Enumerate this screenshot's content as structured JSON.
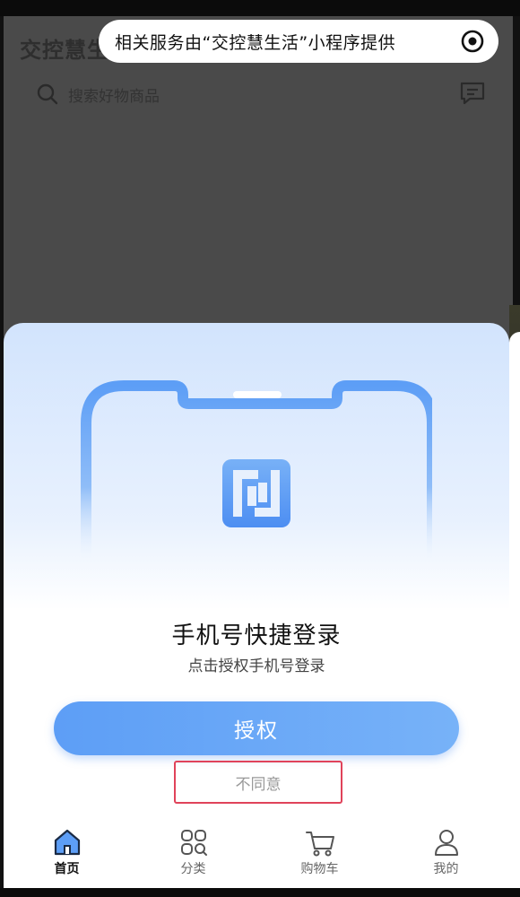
{
  "capsule": {
    "text": "相关服务由“交控慧生活”小程序提供",
    "icon": "target-icon"
  },
  "app": {
    "title": "交控慧生活",
    "search_placeholder": "搜索好物商品",
    "message_icon": "message-icon"
  },
  "login": {
    "title": "手机号快捷登录",
    "subtitle": "点击授权手机号登录",
    "authorize_label": "授权",
    "disagree_label": "不同意"
  },
  "tabbar": {
    "items": [
      {
        "label": "首页",
        "icon": "home-icon",
        "active": true
      },
      {
        "label": "分类",
        "icon": "category-icon",
        "active": false
      },
      {
        "label": "购物车",
        "icon": "cart-icon",
        "active": false
      },
      {
        "label": "我的",
        "icon": "profile-icon",
        "active": false
      }
    ]
  },
  "colors": {
    "accent": "#5d9ef6",
    "highlight_border": "#e0435a",
    "sheet_top": "#d2e4fd"
  }
}
